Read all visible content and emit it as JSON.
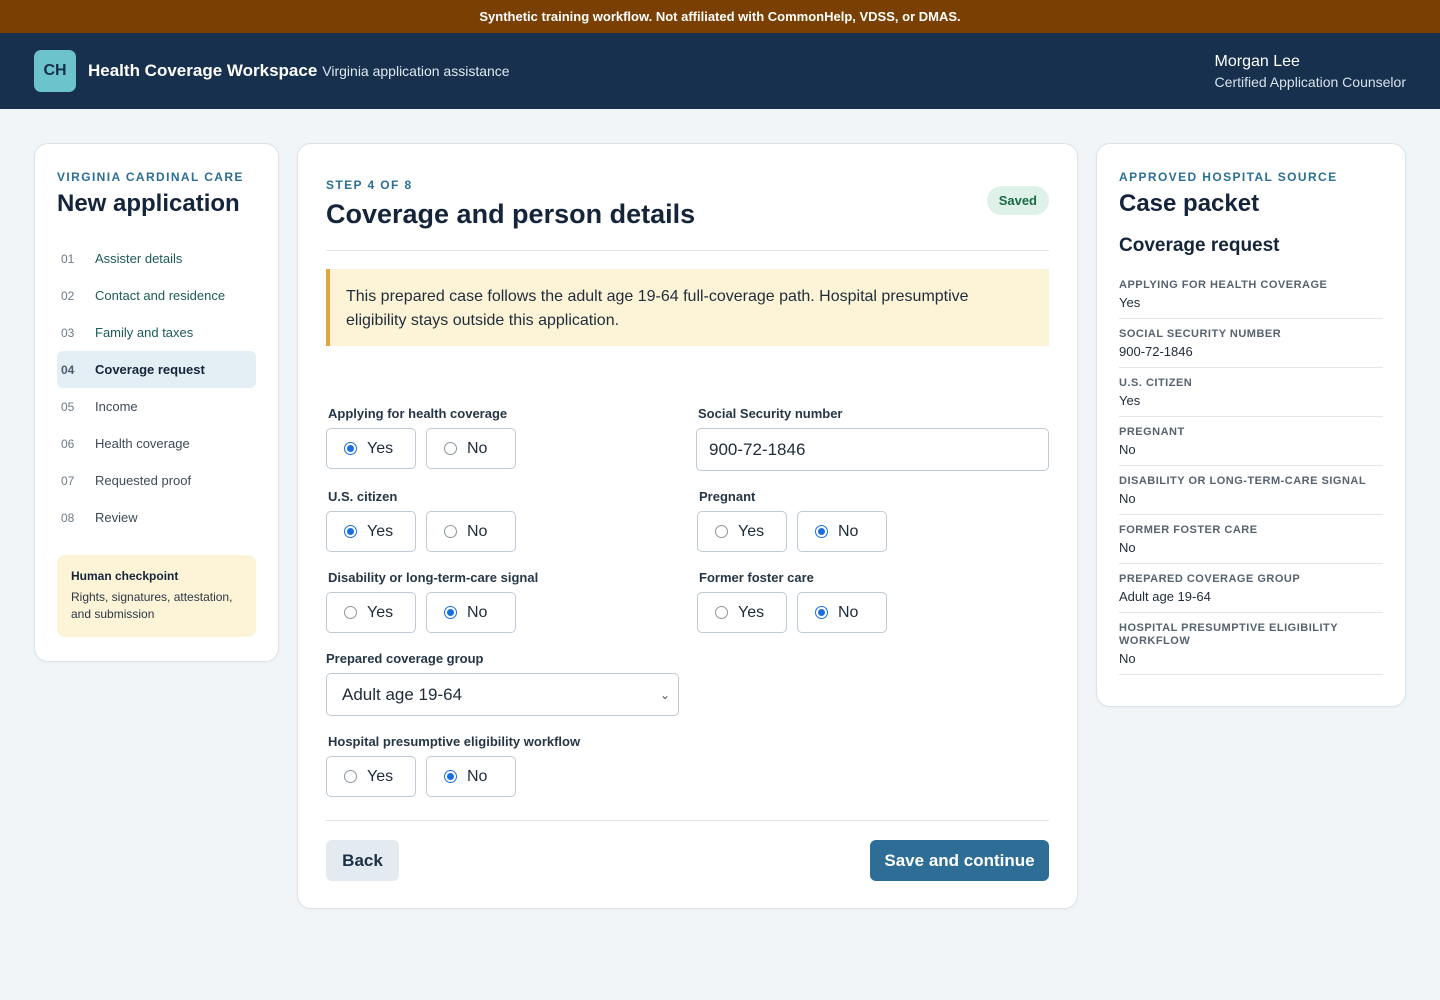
{
  "banner": "Synthetic training workflow. Not affiliated with CommonHelp, VDSS, or DMAS.",
  "header": {
    "logo": "CH",
    "title": "Health Coverage Workspace",
    "subtitle": "Virginia application assistance",
    "user_name": "Morgan Lee",
    "user_role": "Certified Application Counselor"
  },
  "sidebar": {
    "eyebrow": "VIRGINIA CARDINAL CARE",
    "title": "New application",
    "steps": [
      {
        "num": "01",
        "label": "Assister details"
      },
      {
        "num": "02",
        "label": "Contact and residence"
      },
      {
        "num": "03",
        "label": "Family and taxes"
      },
      {
        "num": "04",
        "label": "Coverage request"
      },
      {
        "num": "05",
        "label": "Income"
      },
      {
        "num": "06",
        "label": "Health coverage"
      },
      {
        "num": "07",
        "label": "Requested proof"
      },
      {
        "num": "08",
        "label": "Review"
      }
    ],
    "checkpoint_title": "Human checkpoint",
    "checkpoint_text": "Rights, signatures, attestation, and submission"
  },
  "main": {
    "step": "STEP 4 OF 8",
    "title": "Coverage and person details",
    "status": "Saved",
    "notice": "This prepared case follows the adult age 19-64 full-coverage path. Hospital presumptive eligibility stays outside this application.",
    "fields": {
      "applying": {
        "label": "Applying for health coverage",
        "yes": "Yes",
        "no": "No",
        "selected": "Yes"
      },
      "ssn": {
        "label": "Social Security number",
        "value": "900-72-1846"
      },
      "citizen": {
        "label": "U.S. citizen",
        "yes": "Yes",
        "no": "No",
        "selected": "Yes"
      },
      "pregnant": {
        "label": "Pregnant",
        "yes": "Yes",
        "no": "No",
        "selected": "No"
      },
      "disability": {
        "label": "Disability or long-term-care signal",
        "yes": "Yes",
        "no": "No",
        "selected": "No"
      },
      "foster": {
        "label": "Former foster care",
        "yes": "Yes",
        "no": "No",
        "selected": "No"
      },
      "group": {
        "label": "Prepared coverage group",
        "value": "Adult age 19-64"
      },
      "hpe": {
        "label": "Hospital presumptive eligibility workflow",
        "yes": "Yes",
        "no": "No",
        "selected": "No"
      }
    },
    "back_label": "Back",
    "next_label": "Save and continue"
  },
  "packet": {
    "eyebrow": "APPROVED HOSPITAL SOURCE",
    "title": "Case packet",
    "section": "Coverage request",
    "facts": [
      {
        "key": "APPLYING FOR HEALTH COVERAGE",
        "value": "Yes"
      },
      {
        "key": "SOCIAL SECURITY NUMBER",
        "value": "900-72-1846"
      },
      {
        "key": "U.S. CITIZEN",
        "value": "Yes"
      },
      {
        "key": "PREGNANT",
        "value": "No"
      },
      {
        "key": "DISABILITY OR LONG-TERM-CARE SIGNAL",
        "value": "No"
      },
      {
        "key": "FORMER FOSTER CARE",
        "value": "No"
      },
      {
        "key": "PREPARED COVERAGE GROUP",
        "value": "Adult age 19-64"
      },
      {
        "key": "HOSPITAL PRESUMPTIVE ELIGIBILITY WORKFLOW",
        "value": "No"
      }
    ]
  },
  "colors": {
    "accent": "#2e6d96",
    "header": "#17304d",
    "banner": "#7a3f02",
    "notice": "#fdf3d6",
    "saved": "#1b6a44"
  }
}
